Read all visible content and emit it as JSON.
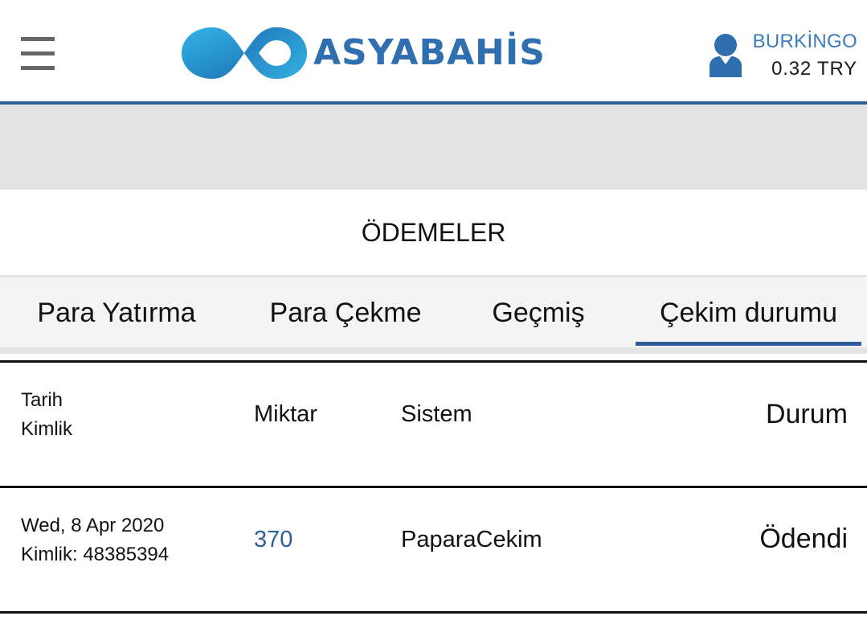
{
  "header": {
    "brand": "ASYABAHİS",
    "username": "BURKİNGO",
    "balance": "0.32 TRY",
    "icons": {
      "menu": "hamburger-menu-icon",
      "user": "user-icon"
    },
    "colors": {
      "brand_blue": "#2f6fb0",
      "accent_line": "#2f5d9a",
      "username": "#3a7dbf"
    }
  },
  "page": {
    "title": "ÖDEMELER"
  },
  "tabs": [
    {
      "label": "Para Yatırma",
      "active": false
    },
    {
      "label": "Para Çekme",
      "active": false
    },
    {
      "label": "Geçmiş",
      "active": false
    },
    {
      "label": "Çekim durumu",
      "active": true
    }
  ],
  "table": {
    "headers": {
      "date": "Tarih",
      "id": "Kimlik",
      "amount": "Miktar",
      "system": "Sistem",
      "status": "Durum"
    },
    "rows": [
      {
        "date": "Wed, 8 Apr 2020",
        "id": "Kimlik: 48385394",
        "amount": "370",
        "system": "PaparaCekim",
        "status": "Ödendi"
      }
    ]
  }
}
